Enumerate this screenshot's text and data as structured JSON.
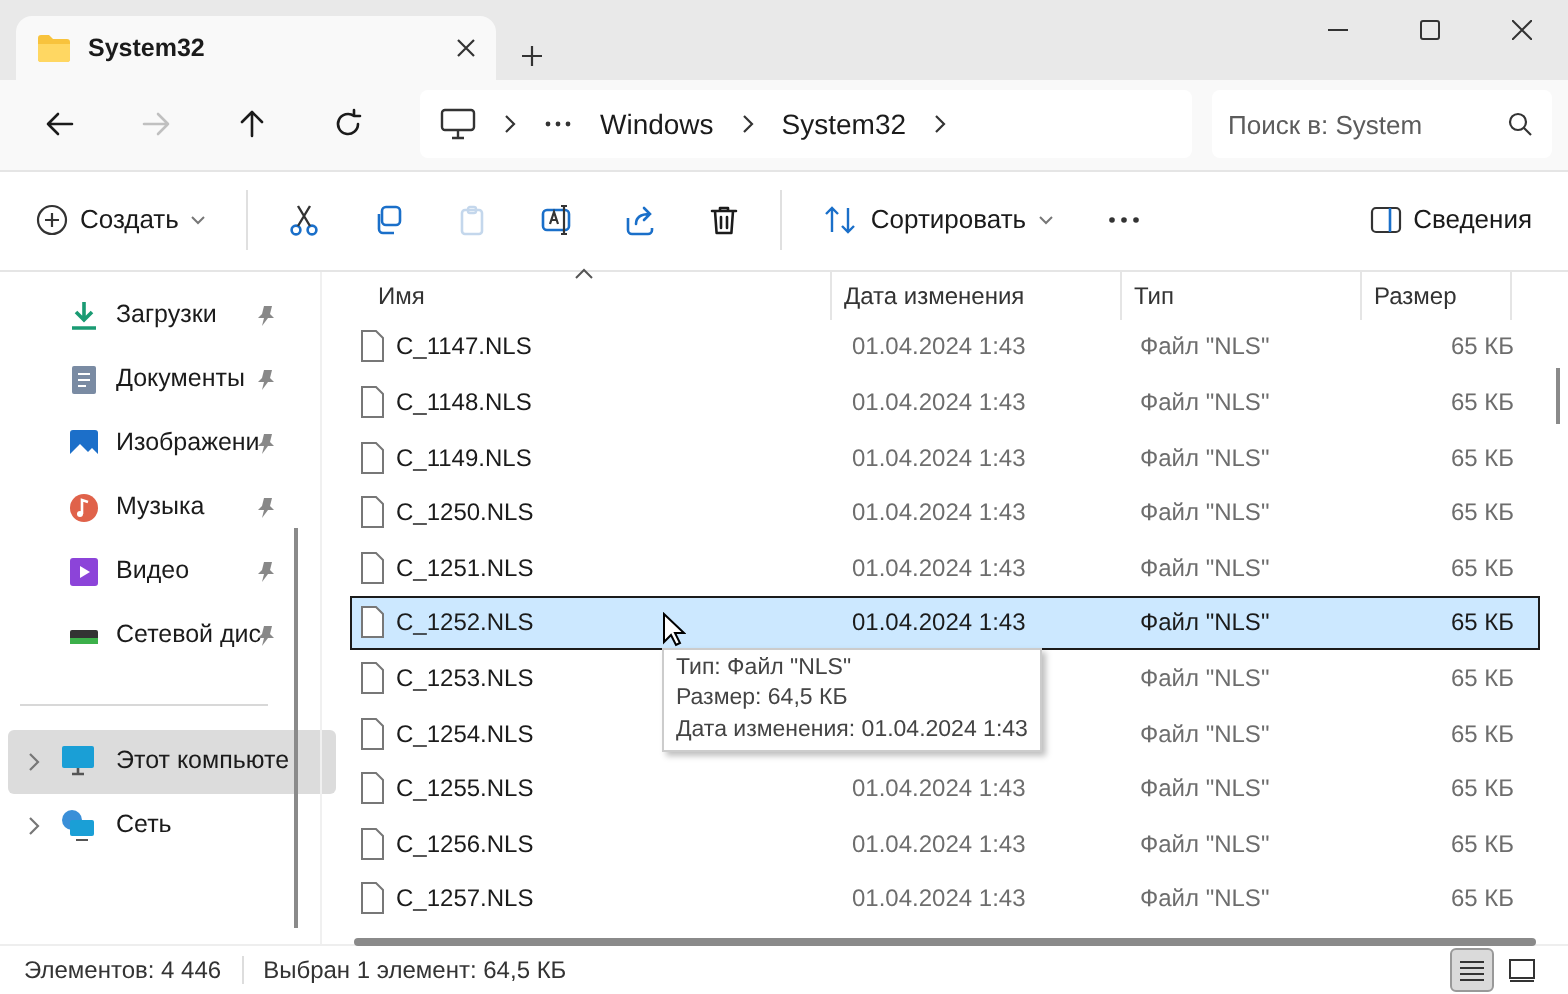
{
  "tabs": [
    {
      "title": "System32",
      "selected": true
    }
  ],
  "nav": [
    {
      "kind": "back",
      "disabled": false
    },
    {
      "kind": "forward",
      "disabled": true
    },
    {
      "kind": "up",
      "disabled": false
    },
    {
      "kind": "refresh",
      "disabled": false
    }
  ],
  "breadcrumb": [
    "Windows",
    "System32"
  ],
  "search": {
    "placeholder": "Поиск в: System"
  },
  "commands": [
    {
      "kind": "new",
      "label": "Создать",
      "disabled": false
    },
    {
      "kind": "cut",
      "disabled": false
    },
    {
      "kind": "copy",
      "disabled": false
    },
    {
      "kind": "paste",
      "disabled": true
    },
    {
      "kind": "rename",
      "disabled": false
    },
    {
      "kind": "share",
      "disabled": false
    },
    {
      "kind": "delete",
      "disabled": false
    },
    {
      "kind": "sort",
      "label": "Сортировать",
      "disabled": false
    },
    {
      "kind": "more",
      "disabled": false
    }
  ],
  "details_button": {
    "label": "Сведения"
  },
  "sidebar": {
    "pinned": [
      {
        "kind": "downloads",
        "label": "Загрузки"
      },
      {
        "kind": "documents",
        "label": "Документы"
      },
      {
        "kind": "pictures",
        "label": "Изображени"
      },
      {
        "kind": "music",
        "label": "Музыка"
      },
      {
        "kind": "videos",
        "label": "Видео"
      },
      {
        "kind": "network-drive",
        "label": "Сетевой дис"
      }
    ],
    "roots": [
      {
        "kind": "computer",
        "label": "Этот компьюте",
        "selected": true
      },
      {
        "kind": "network",
        "label": "Сеть",
        "selected": false
      }
    ]
  },
  "table": {
    "columns": [
      {
        "label": "Имя",
        "sorted": true
      },
      {
        "label": "Дата изменения",
        "sorted": false
      },
      {
        "label": "Тип",
        "sorted": false
      },
      {
        "label": "Размер",
        "sorted": false
      }
    ],
    "rows": [
      {
        "name": "C_1147.NLS",
        "date": "01.04.2024 1:43",
        "type": "Файл \"NLS\"",
        "size": "65 КБ",
        "selected": false
      },
      {
        "name": "C_1148.NLS",
        "date": "01.04.2024 1:43",
        "type": "Файл \"NLS\"",
        "size": "65 КБ",
        "selected": false
      },
      {
        "name": "C_1149.NLS",
        "date": "01.04.2024 1:43",
        "type": "Файл \"NLS\"",
        "size": "65 КБ",
        "selected": false
      },
      {
        "name": "C_1250.NLS",
        "date": "01.04.2024 1:43",
        "type": "Файл \"NLS\"",
        "size": "65 КБ",
        "selected": false
      },
      {
        "name": "C_1251.NLS",
        "date": "01.04.2024 1:43",
        "type": "Файл \"NLS\"",
        "size": "65 КБ",
        "selected": false
      },
      {
        "name": "C_1252.NLS",
        "date": "01.04.2024 1:43",
        "type": "Файл \"NLS\"",
        "size": "65 КБ",
        "selected": true
      },
      {
        "name": "C_1253.NLS",
        "type": "Файл \"NLS\"",
        "size": "65 КБ",
        "selected": false
      },
      {
        "name": "C_1254.NLS",
        "type": "Файл \"NLS\"",
        "size": "65 КБ",
        "selected": false
      },
      {
        "name": "C_1255.NLS",
        "date": "01.04.2024 1:43",
        "type": "Файл \"NLS\"",
        "size": "65 КБ",
        "selected": false
      },
      {
        "name": "C_1256.NLS",
        "date": "01.04.2024 1:43",
        "type": "Файл \"NLS\"",
        "size": "65 КБ",
        "selected": false
      },
      {
        "name": "C_1257.NLS",
        "date": "01.04.2024 1:43",
        "type": "Файл \"NLS\"",
        "size": "65 КБ",
        "selected": false
      }
    ]
  },
  "tooltip": [
    "Тип: Файл \"NLS\"",
    "Размер: 64,5 КБ",
    "Дата изменения: 01.04.2024 1:43"
  ],
  "status_bar": {
    "count": "Элементов: 4 446",
    "selection": "Выбран 1 элемент: 64,5 КБ",
    "views": [
      {
        "kind": "details",
        "selected": true
      },
      {
        "kind": "tiles",
        "selected": false
      }
    ]
  }
}
